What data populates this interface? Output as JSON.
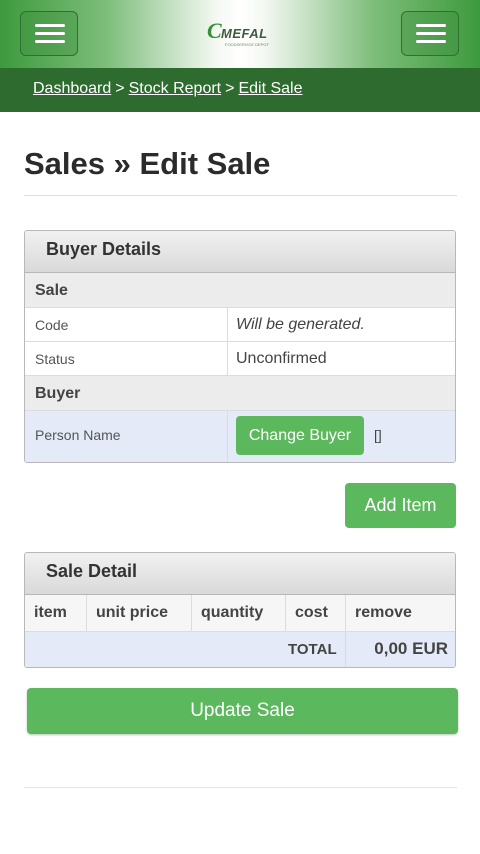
{
  "header": {
    "logo": {
      "name": "MEFAL",
      "mark": "C",
      "tagline": "FOODSERVICE DEPOT"
    }
  },
  "breadcrumb": {
    "items": [
      "Dashboard",
      "Stock Report",
      "Edit Sale"
    ],
    "separator": ">"
  },
  "page": {
    "title": "Sales » Edit Sale"
  },
  "buyer_details": {
    "heading": "Buyer Details",
    "sale_section": "Sale",
    "code_label": "Code",
    "code_value": "Will be generated.",
    "status_label": "Status",
    "status_value": "Unconfirmed",
    "buyer_section": "Buyer",
    "person_label": "Person Name",
    "change_buyer_label": "Change Buyer",
    "person_value": "[]"
  },
  "add_item_label": "Add Item",
  "sale_detail": {
    "heading": "Sale Detail",
    "columns": [
      "item",
      "unit price",
      "quantity",
      "cost",
      "remove"
    ],
    "total_label": "TOTAL",
    "total_value": "0,00 EUR"
  },
  "update_sale_label": "Update Sale",
  "colors": {
    "primary_green": "#5cb85c",
    "header_dark_green": "#2e6b2f",
    "row_highlight": "#e4eaf7"
  },
  "icons": {
    "menu_left": "hamburger-menu-icon",
    "menu_right": "hamburger-menu-icon"
  }
}
